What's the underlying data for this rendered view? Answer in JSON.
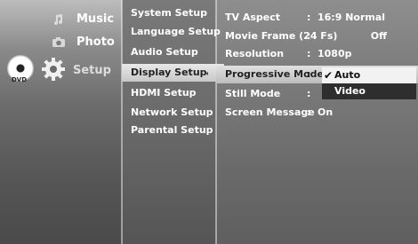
{
  "main_menu": {
    "music": "Music",
    "photo": "Photo",
    "setup": "Setup",
    "dvd_label": "DVD"
  },
  "setup_menu": {
    "items": [
      "System Setup",
      "Language Setup",
      "Audio Setup",
      "Display Setup",
      "HDMI Setup",
      "Network Setup",
      "Parental Setup"
    ]
  },
  "display_settings": {
    "tv_aspect": {
      "label": "TV Aspect",
      "value": "16:9 Normal"
    },
    "movie_frame": {
      "label": "Movie Frame (24 Fs)",
      "value": "Off"
    },
    "resolution": {
      "label": "Resolution",
      "value": "1080p"
    },
    "progressive_mode": {
      "label": "Progressive Mode",
      "value": ""
    },
    "still_mode": {
      "label": "Still Mode",
      "value": ""
    },
    "screen_message": {
      "label": "Screen Message",
      "value": "On"
    },
    "colon": ":"
  },
  "progressive_dropdown": {
    "options": [
      "Auto",
      "Video"
    ],
    "selected": "Auto",
    "highlighted": "Video",
    "check_glyph": "✔"
  },
  "submenu_arrow": "◂"
}
